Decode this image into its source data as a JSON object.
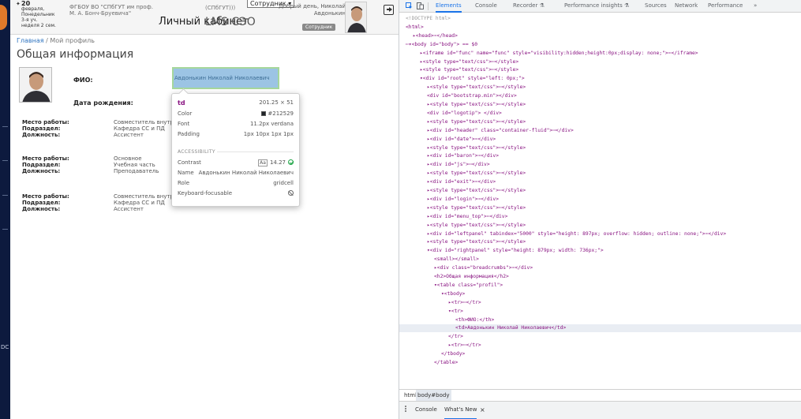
{
  "left_strip": {
    "tick_label": "DC"
  },
  "header": {
    "date_day": "20",
    "date_lines": [
      "февраля,",
      "Понедельник",
      "3-я уч.",
      "неделя 2 сем."
    ],
    "university": "ФГБОУ ВО \"СПбГУТ им проф. М. А. Бонч-Бруевича\"",
    "cabinet_title": "Личный кабинет",
    "spbgut": "(СПбГУТ)))",
    "employee_select": "Сотрудник",
    "lms_title": "LMS СЭО",
    "greeting": "Добрый день, Николай Авдонькин",
    "role_badge": "Сотрудник"
  },
  "breadcrumb": {
    "home": "Главная",
    "separator": " / ",
    "current": "Мой профиль"
  },
  "page_title": "Общая информация",
  "profile": {
    "fio_label": "ФИО:",
    "fio_value": "Авдонькин Николай Николаевич",
    "birth_label": "Дата рождения:"
  },
  "jobs": [
    {
      "rows": [
        {
          "k": "Место работы:",
          "v": "Совместитель внутренний"
        },
        {
          "k": "Подраздел:",
          "v": "Кафедра СС и ПД"
        },
        {
          "k": "Должность:",
          "v": "Ассистент"
        }
      ]
    },
    {
      "rows": [
        {
          "k": "Место работы:",
          "v": "Основное"
        },
        {
          "k": "Подраздел:",
          "v": "Учебная часть"
        },
        {
          "k": "Должность:",
          "v": "Преподаватель"
        }
      ]
    },
    {
      "rows": [
        {
          "k": "Место работы:",
          "v": "Совместитель внутренний"
        },
        {
          "k": "Подраздел:",
          "v": "Кафедра СС и ПД"
        },
        {
          "k": "Должность:",
          "v": "Ассистент"
        }
      ]
    }
  ],
  "tooltip": {
    "tag": "td",
    "dimensions": "201.25 × 51",
    "color_label": "Color",
    "color_value": "#212529",
    "font_label": "Font",
    "font_value": "11.2px verdana",
    "padding_label": "Padding",
    "padding_value": "1px 10px 1px 1px",
    "accessibility_label": "ACCESSIBILITY",
    "contrast_label": "Contrast",
    "contrast_aa": "Aa",
    "contrast_value": "14.27",
    "name_label": "Name",
    "name_value": "Авдонькин Николай Николаевич",
    "role_label": "Role",
    "role_value": "gridcell",
    "keyboard_label": "Keyboard-focusable"
  },
  "devtools": {
    "tabs": [
      "Elements",
      "Console",
      "Recorder",
      "Performance insights",
      "Sources",
      "Network",
      "Performance",
      "»"
    ],
    "active_tab": "Elements",
    "dom_lines": [
      "<!DOCTYPE html>",
      "<html>",
      "▸<head>⋯</head>",
      "⋯▾<body id=\"body\"> == $0",
      "▸<iframe id=\"func\" name=\"func\" style=\"visibility:hidden;height:0px;display: none;\">⋯</iframe>",
      "▸<style type=\"text/css\">⋯</style>",
      "▸<style type=\"text/css\">⋯</style>",
      "▾<div id=\"root\" style=\"left: 0px;\">",
      "▸<style type=\"text/css\">⋯</style>",
      "<div id=\"bootstrap.min\"></div>",
      "▸<style type=\"text/css\">⋯</style>",
      "<div id=\"logotip\"> </div>",
      "▸<style type=\"text/css\">⋯</style>",
      "▸<div id=\"header\" class=\"container-fluid\">⋯</div>",
      "▸<div id=\"date\">⋯</div>",
      "▸<style type=\"text/css\">⋯</style>",
      "▸<div id=\"baron\">⋯</div>",
      "▸<div id=\"js\">⋯</div>",
      "▸<style type=\"text/css\">⋯</style>",
      "▸<div id=\"exit\">⋯</div>",
      "▸<style type=\"text/css\">⋯</style>",
      "▸<div id=\"login\">⋯</div>",
      "▸<style type=\"text/css\">⋯</style>",
      "▸<div id=\"menu_top\">⋯</div>",
      "▸<style type=\"text/css\">⋯</style>",
      "▸<div id=\"leftpanel\" tabindex=\"5000\" style=\"height: 897px; overflow: hidden; outline: none;\">⋯</div>",
      "▸<style type=\"text/css\">⋯</style>",
      "▾<div id=\"rightpanel\" style=\"height: 879px; width: 736px;\">",
      "<small></small>",
      "▸<div class=\"breadcrumbs\">⋯</div>",
      "<h2>Общая информация</h2>",
      "▾<table class=\"profil\">",
      "▾<tbody>",
      "▸<tr>⋯</tr>",
      "▾<tr>",
      "<th>ФИО:</th>",
      "<td>Авдонькин Николай Николаевич</td>",
      "</tr>",
      "▸<tr>⋯</tr>",
      "</tbody>",
      "</table>"
    ],
    "breadcrumbs": [
      "html",
      "body#body"
    ],
    "drawer_tabs": [
      "Console",
      "What's New"
    ],
    "active_drawer_tab": "What's New"
  }
}
